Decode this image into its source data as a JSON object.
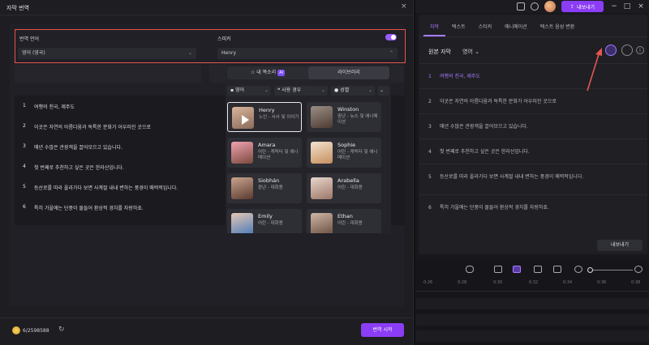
{
  "dialog": {
    "title": "자막 번역",
    "close": "×",
    "translate_language_label": "번역 언어",
    "translate_language_value": "영어 (영국)",
    "speaker_label": "스피커",
    "speaker_value": "Henry",
    "subtitles": [
      {
        "num": "1",
        "text": "여행의 천국, 제주도"
      },
      {
        "num": "2",
        "text": "이곳은 자연의 아름다움과 독특한 문화가 어우러진 곳으로"
      },
      {
        "num": "3",
        "text": "매년 수많은 관광객을 끌어모으고 있습니다."
      },
      {
        "num": "4",
        "text": "첫 번째로 추천하고 싶은 곳은 한라산입니다."
      },
      {
        "num": "5",
        "text": "등산로를 따라 올라가다 보면 사계절 내내 변하는 풍경이 매력적입니다."
      },
      {
        "num": "6",
        "text": "특히 가을에는 단풍이 물들어 환상적 경치를 자랑하죠."
      }
    ],
    "credits": "6/2598588",
    "start_button": "번역 시작"
  },
  "voice_popup": {
    "tab_my_voice": "내 목소리",
    "tab_ai_badge": "AI",
    "tab_library": "라이브러리",
    "filter_language": "영어",
    "filter_usage": "사용 경우",
    "filter_gender": "성별",
    "voices": [
      {
        "name": "Henry",
        "desc": "노인 - 서사 및 이야기"
      },
      {
        "name": "Winston",
        "desc": "중년 - 뉴스 및 애니메이션"
      },
      {
        "name": "Amara",
        "desc": "어린 - 캐릭터 및 애니메이션"
      },
      {
        "name": "Sophie",
        "desc": "어린 - 캐릭터 및 애니메이션"
      },
      {
        "name": "Siobhán",
        "desc": "중년 - 대화용"
      },
      {
        "name": "Arabella",
        "desc": "어린 - 대화용"
      },
      {
        "name": "Emily",
        "desc": "어린 - 대화용"
      },
      {
        "name": "Ethan",
        "desc": "어린 - 대화용"
      }
    ]
  },
  "app": {
    "export_top": "내보내기",
    "tabs": [
      "자막",
      "텍스트",
      "스티커",
      "애니메이션",
      "텍스트 음성 변환"
    ],
    "source_label": "원본 자막",
    "source_lang": "영어",
    "export_bottom": "내보내기",
    "timeline_ticks": [
      "0:26",
      "0:28",
      "0:30",
      "0:32",
      "0:34",
      "0:36",
      "0:38"
    ]
  },
  "colors": {
    "accent": "#8b3df5",
    "highlight": "#a97cff",
    "annotation": "#e4574e"
  }
}
